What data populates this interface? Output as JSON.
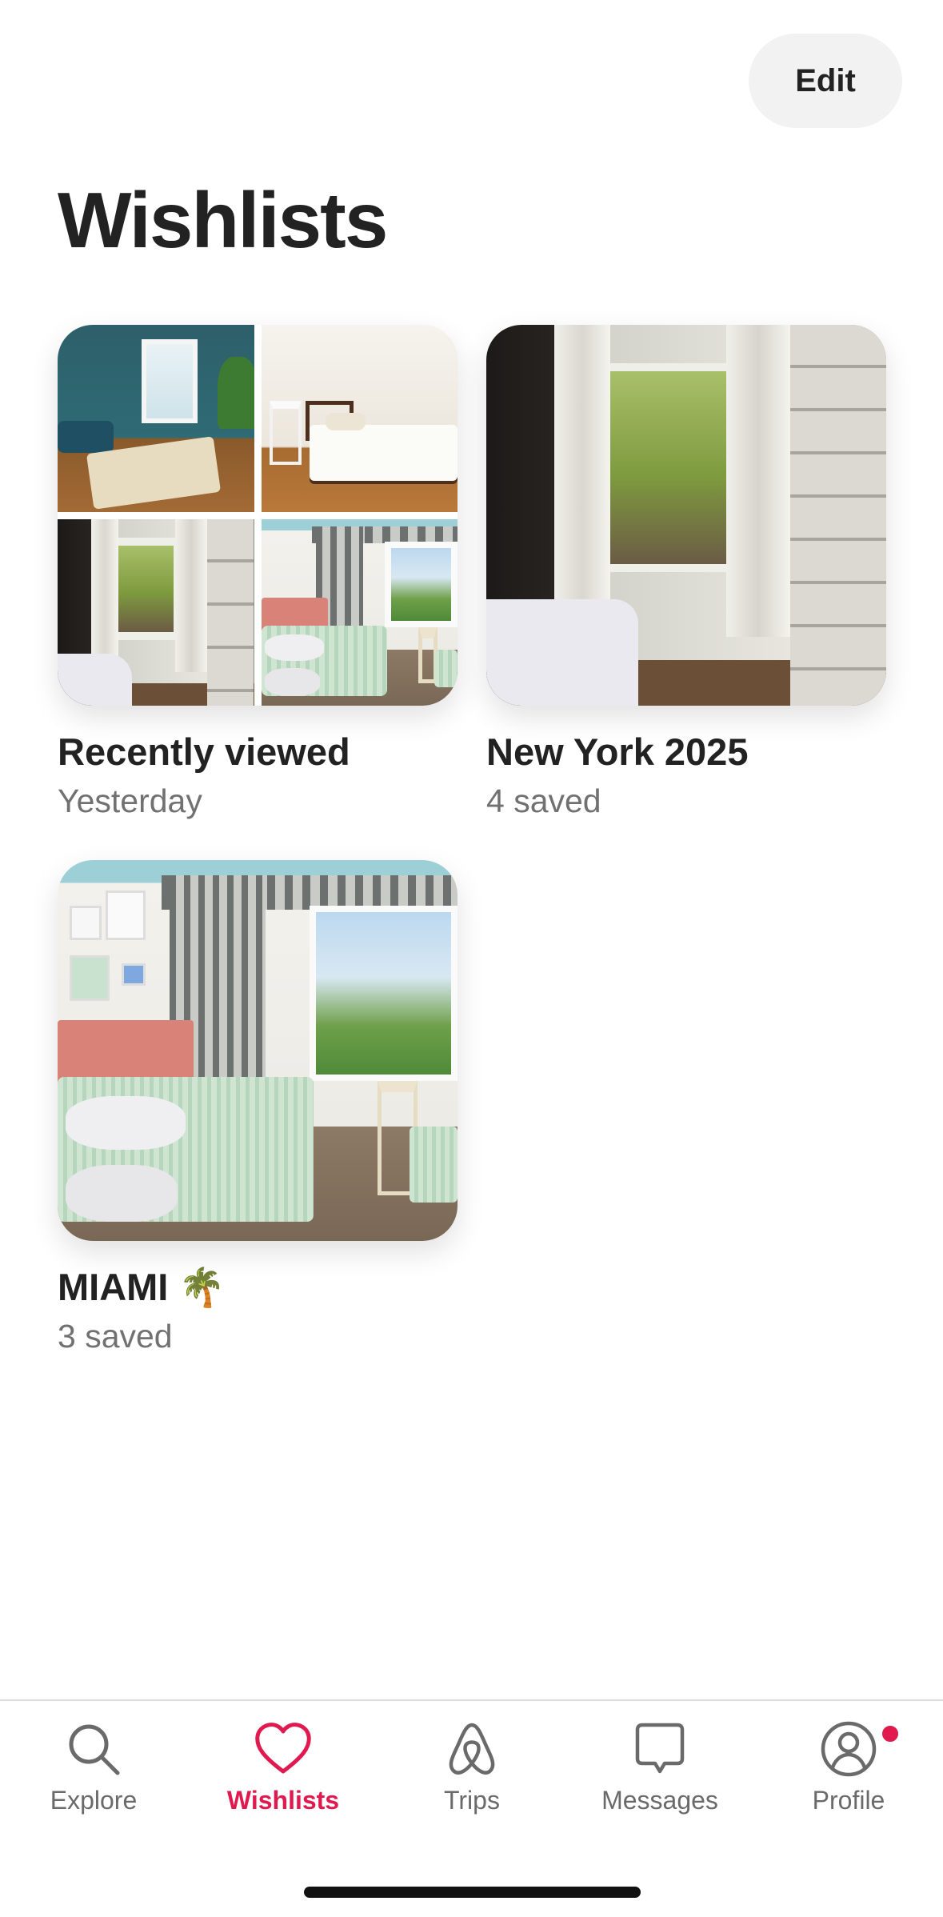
{
  "header": {
    "edit_label": "Edit",
    "title": "Wishlists"
  },
  "wishlists": [
    {
      "title": "Recently viewed",
      "subtitle": "Yesterday"
    },
    {
      "title": "New York 2025",
      "subtitle": "4 saved"
    },
    {
      "title": "MIAMI 🌴",
      "subtitle": "3 saved"
    }
  ],
  "tabbar": {
    "items": [
      {
        "label": "Explore",
        "icon": "search-icon",
        "active": false
      },
      {
        "label": "Wishlists",
        "icon": "heart-icon",
        "active": true
      },
      {
        "label": "Trips",
        "icon": "airbnb-logo-icon",
        "active": false
      },
      {
        "label": "Messages",
        "icon": "message-icon",
        "active": false
      },
      {
        "label": "Profile",
        "icon": "profile-icon",
        "active": false,
        "has_notification": true
      }
    ]
  },
  "colors": {
    "accent": "#e0194f",
    "text": "#222222",
    "muted": "#717171"
  }
}
